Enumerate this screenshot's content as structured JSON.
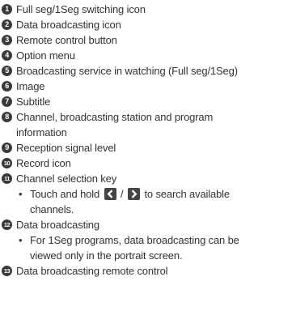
{
  "items": [
    {
      "num": "1",
      "label": "Full seg/1Seg switching icon"
    },
    {
      "num": "2",
      "label": "Data broadcasting icon"
    },
    {
      "num": "3",
      "label": "Remote control button"
    },
    {
      "num": "4",
      "label": "Option menu"
    },
    {
      "num": "5",
      "label": "Broadcasting service in watching (Full seg/1Seg)"
    },
    {
      "num": "6",
      "label": "Image"
    },
    {
      "num": "7",
      "label": "Subtitle"
    },
    {
      "num": "8",
      "label": "Channel, broadcasting station and program",
      "continuation": "information"
    },
    {
      "num": "9",
      "label": "Reception signal level"
    },
    {
      "num": "10",
      "label": "Record icon"
    },
    {
      "num": "11",
      "label": "Channel selection key"
    },
    {
      "num": "12",
      "label": "Data broadcasting"
    },
    {
      "num": "13",
      "label": "Data broadcasting remote control"
    }
  ],
  "notes": {
    "channel_key": {
      "bullet": "•",
      "text_before": "Touch and hold",
      "separator": "/",
      "text_after": "to search available",
      "continuation": "channels.",
      "left_icon": "chevron-left-icon",
      "right_icon": "chevron-right-icon"
    },
    "data_broadcasting": {
      "bullet": "•",
      "text": "For 1Seg programs, data broadcasting can be",
      "continuation": "viewed only in the portrait screen."
    }
  }
}
